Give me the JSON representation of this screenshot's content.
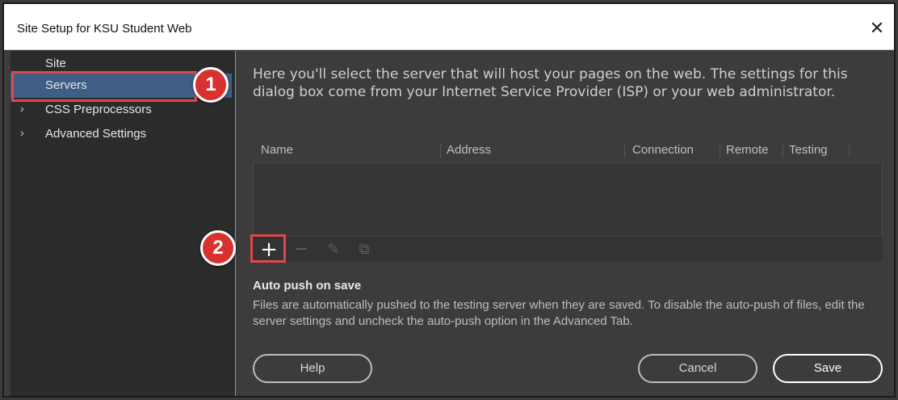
{
  "window": {
    "title": "Site Setup for KSU Student Web",
    "close_glyph": "✕"
  },
  "sidebar": {
    "items": [
      {
        "label": "Site",
        "chevron": "",
        "selected": false
      },
      {
        "label": "Servers",
        "chevron": "",
        "selected": true
      },
      {
        "label": "CSS Preprocessors",
        "chevron": "›",
        "selected": false
      },
      {
        "label": "Advanced Settings",
        "chevron": "›",
        "selected": false
      }
    ]
  },
  "callouts": {
    "first": "1",
    "second": "2"
  },
  "main": {
    "intro": "Here you'll select the server that will host your pages on the web. The settings for this dialog box come from your Internet Service Provider (ISP) or your web administrator.",
    "table": {
      "columns": [
        "Name",
        "Address",
        "Connection",
        "Remote",
        "Testing"
      ]
    },
    "toolbar": {
      "add_icon": "+",
      "remove_icon": "−",
      "edit_icon": "✎",
      "duplicate_icon": "⧉"
    },
    "autopush": {
      "title": "Auto push on save",
      "text": "Files are automatically pushed to the testing server when they are saved. To disable the auto-push of files, edit the server settings and uncheck the auto-push option in the Advanced Tab."
    }
  },
  "buttons": {
    "help": "Help",
    "cancel": "Cancel",
    "save": "Save"
  },
  "colors": {
    "selected_bg": "#3e5e86",
    "callout_red": "#d8312f"
  }
}
